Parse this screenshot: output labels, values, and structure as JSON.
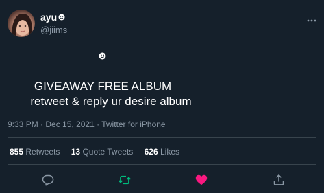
{
  "tweet": {
    "display_name": "ayu",
    "handle": "@jiims",
    "emoji": "☻",
    "line1": "GIVEAWAY FREE ALBUM",
    "line2": "retweet & reply ur desire album",
    "time": "9:33 PM",
    "separator": " · ",
    "date": "Dec 15, 2021",
    "source": "Twitter for iPhone"
  },
  "stats": {
    "retweets_count": "855",
    "retweets_label": "Retweets",
    "quotes_count": "13",
    "quotes_label": "Quote Tweets",
    "likes_count": "626",
    "likes_label": "Likes"
  },
  "actions": {
    "reply_icon": "reply-icon",
    "retweet_icon": "retweet-icon",
    "like_icon": "heart-icon",
    "share_icon": "share-icon"
  },
  "colors": {
    "background": "#15202b",
    "text_primary": "#ffffff",
    "text_secondary": "#8b98a5",
    "divider": "#38444d",
    "retweet_active": "#00ba7c",
    "like_active": "#f91880"
  }
}
